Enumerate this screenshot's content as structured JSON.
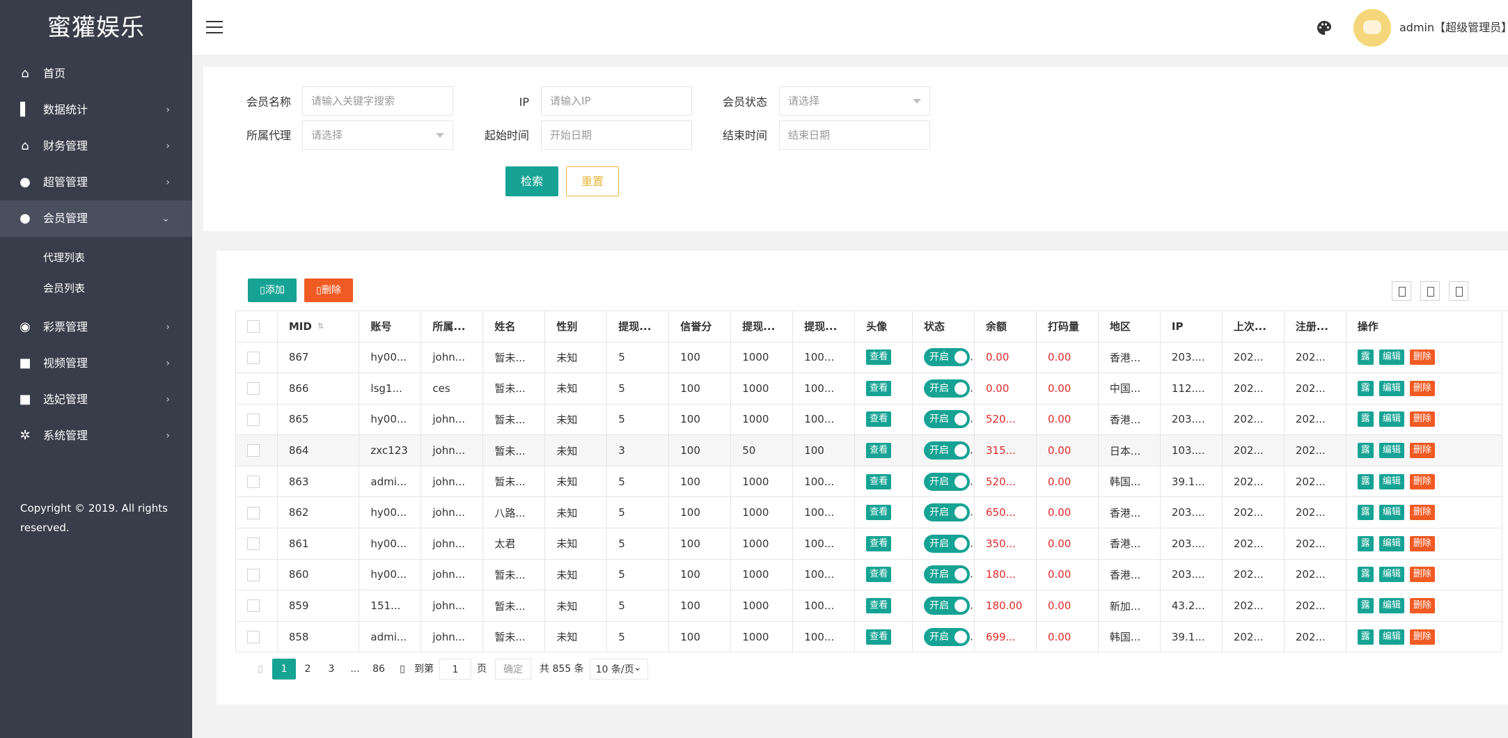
{
  "brand": "蜜獾娱乐",
  "sidebar": {
    "items": [
      {
        "label": "首页",
        "icon": "home-icon",
        "glyph": "⌂",
        "arrow": "",
        "active": false
      },
      {
        "label": "数据统计",
        "icon": "chart-icon",
        "glyph": "▌",
        "arrow": "›",
        "active": false
      },
      {
        "label": "财务管理",
        "icon": "bank-icon",
        "glyph": "⌂",
        "arrow": "›",
        "active": false
      },
      {
        "label": "超管管理",
        "icon": "user-icon",
        "glyph": "●",
        "arrow": "›",
        "active": false
      },
      {
        "label": "会员管理",
        "icon": "users-icon",
        "glyph": "●",
        "arrow": "⌄",
        "active": true
      }
    ],
    "sub_items": [
      "代理列表",
      "会员列表"
    ],
    "items_after": [
      {
        "label": "彩票管理",
        "icon": "gamepad-icon",
        "glyph": "◉",
        "arrow": "›"
      },
      {
        "label": "视频管理",
        "icon": "video-icon",
        "glyph": "■",
        "arrow": "›"
      },
      {
        "label": "选妃管理",
        "icon": "camera-icon",
        "glyph": "■",
        "arrow": "›"
      },
      {
        "label": "系统管理",
        "icon": "gear-icon",
        "glyph": "✲",
        "arrow": "›"
      }
    ],
    "copyright": "Copyright © 2019. All rights reserved."
  },
  "header": {
    "user_name": "admin【超级管理员】"
  },
  "filters": {
    "member_name_label": "会员名称",
    "member_name_placeholder": "请输入关键字搜索",
    "ip_label": "IP",
    "ip_placeholder": "请输入IP",
    "status_label": "会员状态",
    "status_value": "请选择",
    "agent_label": "所属代理",
    "agent_value": "请选择",
    "start_label": "起始时间",
    "start_placeholder": "开始日期",
    "end_label": "结束时间",
    "end_placeholder": "结束日期",
    "search_button": "检索",
    "reset_button": "重置"
  },
  "toolbar": {
    "add_label": "添加",
    "delete_label": "删除"
  },
  "table": {
    "columns": [
      "MID",
      "账号",
      "所属...",
      "姓名",
      "性别",
      "提现...",
      "信誉分",
      "提现...",
      "提现...",
      "头像",
      "状态",
      "余额",
      "打码量",
      "地区",
      "IP",
      "上次...",
      "注册...",
      "操作"
    ],
    "view_label": "查看",
    "switch_label": "开启",
    "op_labels": [
      "露",
      "编辑",
      "删除"
    ],
    "rows": [
      {
        "mid": "867",
        "account": "hy00...",
        "agent": "john...",
        "name": "暂未...",
        "gender": "未知",
        "w1": "5",
        "credit": "100",
        "w2": "1000",
        "w3": "100...",
        "balance": "0.00",
        "code": "0.00",
        "region": "香港...",
        "ip": "203....",
        "last": "202...",
        "reg": "202..."
      },
      {
        "mid": "866",
        "account": "lsg1...",
        "agent": "ces",
        "name": "暂未...",
        "gender": "未知",
        "w1": "5",
        "credit": "100",
        "w2": "1000",
        "w3": "100...",
        "balance": "0.00",
        "code": "0.00",
        "region": "中国...",
        "ip": "112....",
        "last": "202...",
        "reg": "202..."
      },
      {
        "mid": "865",
        "account": "hy00...",
        "agent": "john...",
        "name": "暂未...",
        "gender": "未知",
        "w1": "5",
        "credit": "100",
        "w2": "1000",
        "w3": "100...",
        "balance": "520...",
        "code": "0.00",
        "region": "香港...",
        "ip": "203....",
        "last": "202...",
        "reg": "202..."
      },
      {
        "mid": "864",
        "account": "zxc123",
        "agent": "john...",
        "name": "暂未...",
        "gender": "未知",
        "w1": "3",
        "credit": "100",
        "w2": "50",
        "w3": "100",
        "balance": "315...",
        "code": "0.00",
        "region": "日本...",
        "ip": "103....",
        "last": "202...",
        "reg": "202...",
        "highlight": true
      },
      {
        "mid": "863",
        "account": "admi...",
        "agent": "john...",
        "name": "暂未...",
        "gender": "未知",
        "w1": "5",
        "credit": "100",
        "w2": "1000",
        "w3": "100...",
        "balance": "520...",
        "code": "0.00",
        "region": "韩国...",
        "ip": "39.1...",
        "last": "202...",
        "reg": "202..."
      },
      {
        "mid": "862",
        "account": "hy00...",
        "agent": "john...",
        "name": "八路...",
        "gender": "未知",
        "w1": "5",
        "credit": "100",
        "w2": "1000",
        "w3": "100...",
        "balance": "650...",
        "code": "0.00",
        "region": "香港...",
        "ip": "203....",
        "last": "202...",
        "reg": "202..."
      },
      {
        "mid": "861",
        "account": "hy00...",
        "agent": "john...",
        "name": "太君",
        "gender": "未知",
        "w1": "5",
        "credit": "100",
        "w2": "1000",
        "w3": "100...",
        "balance": "350...",
        "code": "0.00",
        "region": "香港...",
        "ip": "203....",
        "last": "202...",
        "reg": "202..."
      },
      {
        "mid": "860",
        "account": "hy00...",
        "agent": "john...",
        "name": "暂未...",
        "gender": "未知",
        "w1": "5",
        "credit": "100",
        "w2": "1000",
        "w3": "100...",
        "balance": "180...",
        "code": "0.00",
        "region": "香港...",
        "ip": "203....",
        "last": "202...",
        "reg": "202..."
      },
      {
        "mid": "859",
        "account": "151...",
        "agent": "john...",
        "name": "暂未...",
        "gender": "未知",
        "w1": "5",
        "credit": "100",
        "w2": "1000",
        "w3": "100...",
        "balance": "180.00",
        "code": "0.00",
        "region": "新加...",
        "ip": "43.2...",
        "last": "202...",
        "reg": "202..."
      },
      {
        "mid": "858",
        "account": "admi...",
        "agent": "john...",
        "name": "暂未...",
        "gender": "未知",
        "w1": "5",
        "credit": "100",
        "w2": "1000",
        "w3": "100...",
        "balance": "699...",
        "code": "0.00",
        "region": "韩国...",
        "ip": "39.1...",
        "last": "202...",
        "reg": "202..."
      }
    ]
  },
  "pager": {
    "pages": [
      "1",
      "2",
      "3",
      "...",
      "86"
    ],
    "current": "1",
    "goto_label": "到第",
    "goto_value": "1",
    "page_unit": "页",
    "confirm_label": "确定",
    "total_label": "共 855 条",
    "page_size": "10 条/页"
  },
  "colors": {
    "sidebar_bg": "#393d49",
    "primary": "#16a394",
    "danger": "#f05a23",
    "warning": "#e9b83c",
    "money_red": "#e02a2a"
  }
}
